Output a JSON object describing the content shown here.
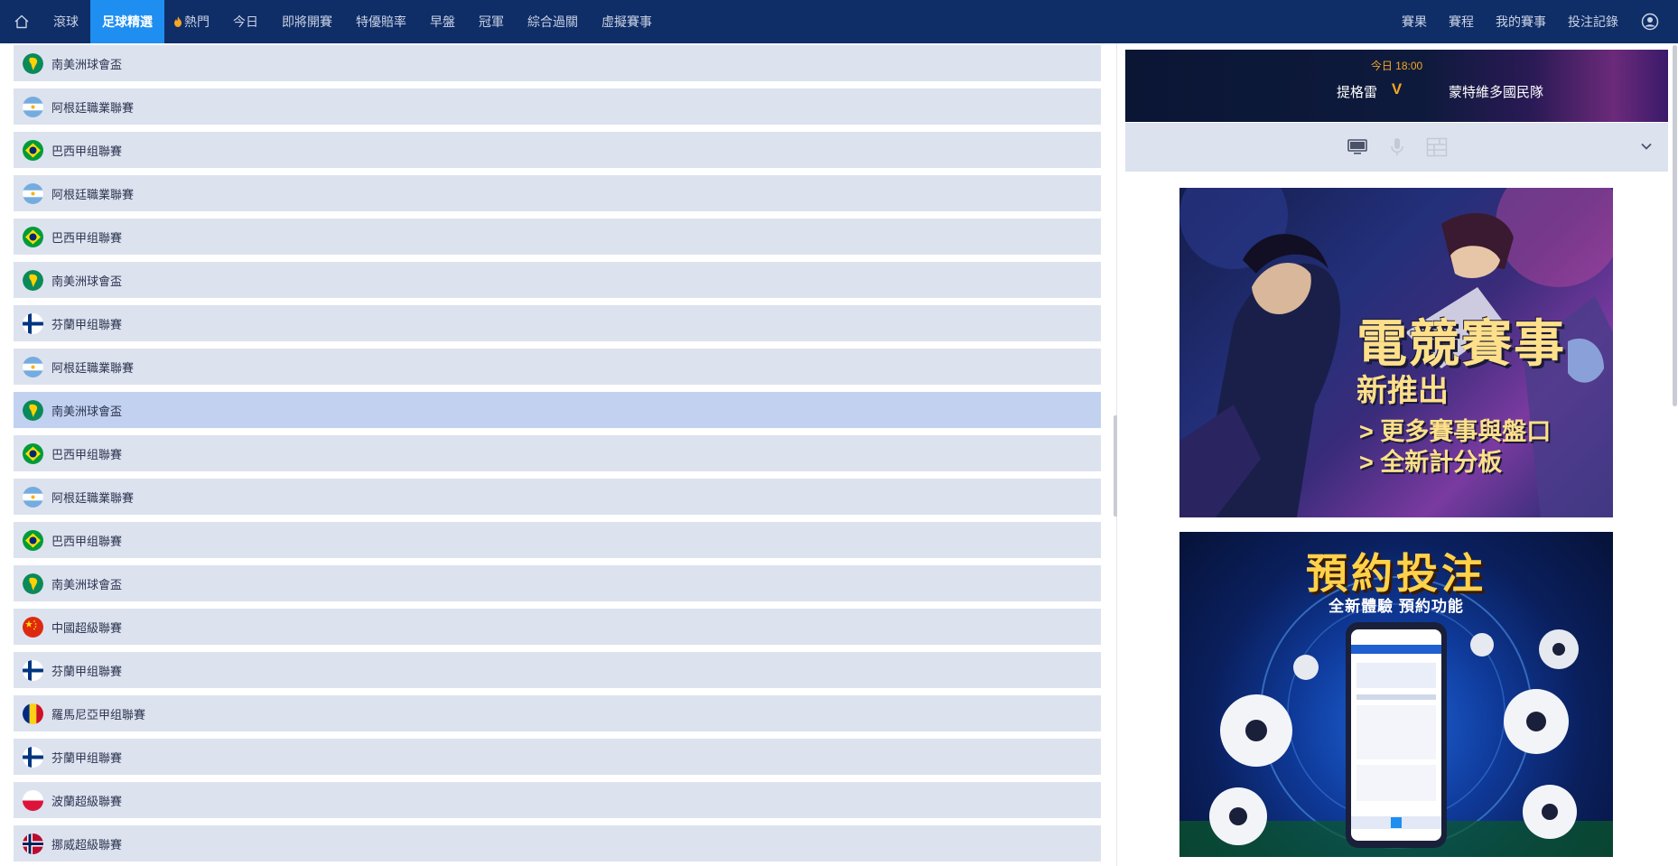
{
  "nav": {
    "items": [
      {
        "label": "滾球",
        "active": false
      },
      {
        "label": "足球精選",
        "active": true
      },
      {
        "label": "熱門",
        "active": false,
        "icon": "fire-icon"
      },
      {
        "label": "今日",
        "active": false
      },
      {
        "label": "即將開賽",
        "active": false
      },
      {
        "label": "特優賠率",
        "active": false
      },
      {
        "label": "早盤",
        "active": false
      },
      {
        "label": "冠軍",
        "active": false
      },
      {
        "label": "綜合過關",
        "active": false
      },
      {
        "label": "虛擬賽事",
        "active": false
      }
    ],
    "right_items": [
      {
        "label": "賽果"
      },
      {
        "label": "賽程"
      },
      {
        "label": "我的賽事"
      },
      {
        "label": "投注記錄"
      }
    ]
  },
  "leagues": [
    {
      "name": "南美洲球會盃",
      "flag": "south-america"
    },
    {
      "name": "阿根廷職業聯賽",
      "flag": "argentina"
    },
    {
      "name": "巴西甲组聯賽",
      "flag": "brazil"
    },
    {
      "name": "阿根廷職業聯賽",
      "flag": "argentina"
    },
    {
      "name": "巴西甲组聯賽",
      "flag": "brazil"
    },
    {
      "name": "南美洲球會盃",
      "flag": "south-america"
    },
    {
      "name": "芬蘭甲组聯賽",
      "flag": "finland"
    },
    {
      "name": "阿根廷職業聯賽",
      "flag": "argentina"
    },
    {
      "name": "南美洲球會盃",
      "flag": "south-america",
      "highlighted": true
    },
    {
      "name": "巴西甲组聯賽",
      "flag": "brazil"
    },
    {
      "name": "阿根廷職業聯賽",
      "flag": "argentina"
    },
    {
      "name": "巴西甲组聯賽",
      "flag": "brazil"
    },
    {
      "name": "南美洲球會盃",
      "flag": "south-america"
    },
    {
      "name": "中國超級聯賽",
      "flag": "china"
    },
    {
      "name": "芬蘭甲组聯賽",
      "flag": "finland"
    },
    {
      "name": "羅馬尼亞甲组聯賽",
      "flag": "romania"
    },
    {
      "name": "芬蘭甲组聯賽",
      "flag": "finland"
    },
    {
      "name": "波蘭超級聯賽",
      "flag": "poland"
    },
    {
      "name": "挪威超級聯賽",
      "flag": "norway"
    }
  ],
  "match": {
    "time": "今日 18:00",
    "home": "提格雷",
    "vs": "V",
    "away": "蒙特維多國民隊"
  },
  "media": {
    "icons": [
      "monitor-icon",
      "microphone-icon",
      "scoreboard-icon"
    ],
    "collapse_icon": "chevron-down-icon"
  },
  "banners": {
    "esports": {
      "title": "電競賽事",
      "subtitle": "新推出",
      "lines": [
        "> 更多賽事與盤口",
        "> 全新計分板"
      ]
    },
    "reserve": {
      "title": "預約投注",
      "subtitle": "全新體驗 預約功能"
    }
  },
  "colors": {
    "nav_bg": "#0f2d66",
    "nav_active": "#1f8ef1",
    "row_bg": "#dde2ef",
    "row_highlight": "#c2d1f0",
    "accent_orange": "#f5a623"
  }
}
